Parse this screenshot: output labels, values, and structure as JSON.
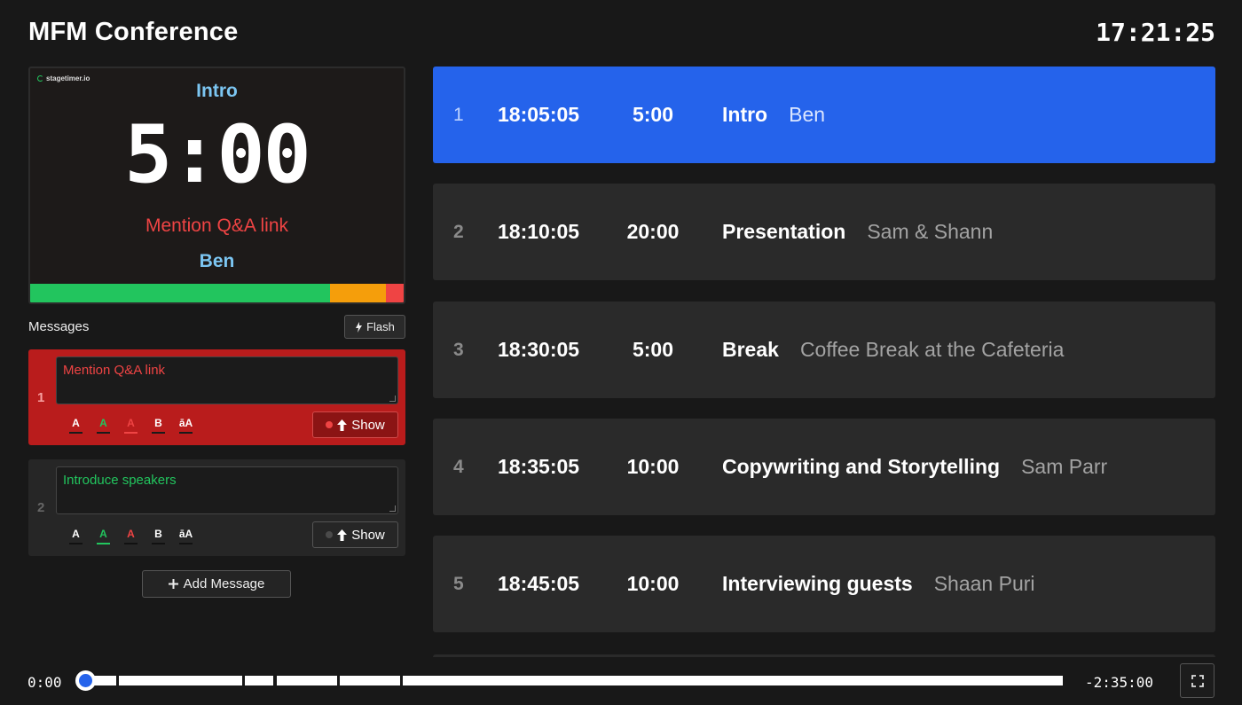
{
  "header": {
    "title": "MFM Conference",
    "clock": "17:21:25"
  },
  "preview": {
    "logo": "stagetimer.io",
    "title": "Intro",
    "time": "5:00",
    "message": "Mention Q&A link",
    "speaker": "Ben",
    "colors": {
      "title": "#7cc6f2",
      "message": "#ef4444",
      "bar_green": "#22c55e",
      "bar_orange": "#f59e0b",
      "bar_red": "#ef4444"
    }
  },
  "messages": {
    "label": "Messages",
    "flash_label": "Flash",
    "items": [
      {
        "num": "1",
        "text": "Mention Q&A link",
        "show_label": "Show",
        "formats": [
          "A",
          "A",
          "A",
          "B",
          "āA"
        ],
        "active": true
      },
      {
        "num": "2",
        "text": "Introduce speakers",
        "show_label": "Show",
        "formats": [
          "A",
          "A",
          "A",
          "B",
          "āA"
        ],
        "active": false
      }
    ],
    "add_label": "Add Message"
  },
  "timers": [
    {
      "num": "1",
      "start": "18:05:05",
      "duration": "5:00",
      "title": "Intro",
      "speaker": "Ben",
      "active": true
    },
    {
      "num": "2",
      "start": "18:10:05",
      "duration": "20:00",
      "title": "Presentation",
      "speaker": "Sam & Shann",
      "active": false
    },
    {
      "num": "3",
      "start": "18:30:05",
      "duration": "5:00",
      "title": "Break",
      "speaker": "Coffee Break at the Cafeteria",
      "active": false
    },
    {
      "num": "4",
      "start": "18:35:05",
      "duration": "10:00",
      "title": "Copywriting and Storytelling",
      "speaker": "Sam Parr",
      "active": false
    },
    {
      "num": "5",
      "start": "18:45:05",
      "duration": "10:00",
      "title": "Interviewing guests",
      "speaker": "Shaan Puri",
      "active": false
    }
  ],
  "timeline": {
    "start": "0:00",
    "remaining": "-2:35:00"
  }
}
